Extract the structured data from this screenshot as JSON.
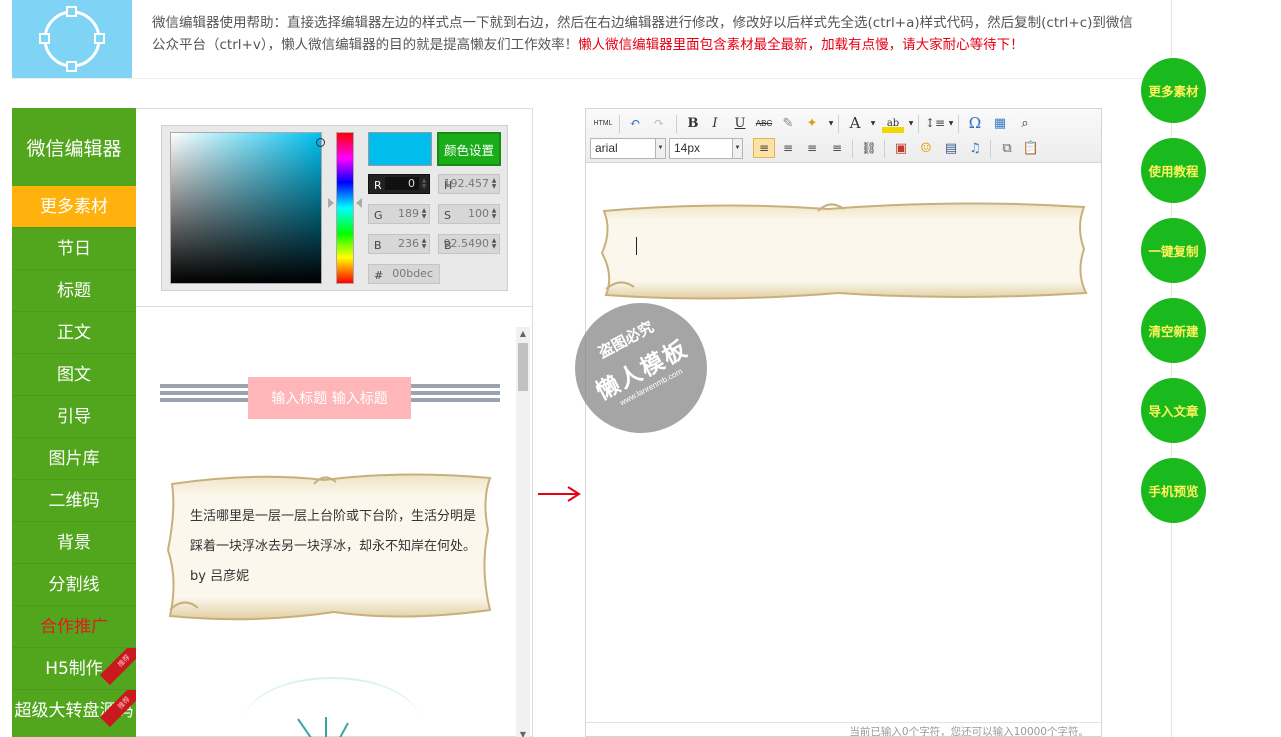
{
  "header": {
    "help_text": "微信编辑器使用帮助：直接选择编辑器左边的样式点一下就到右边，然后在右边编辑器进行修改，修改好以后样式先全选(ctrl+a)样式代码，然后复制(ctrl+c)到微信公众平台（ctrl+v），懒人微信编辑器的目的就是提高懒友们工作效率！",
    "warning_text": "懒人微信编辑器里面包含素材最全最新，加载有点慢，请大家耐心等待下！"
  },
  "nav": {
    "title": "微信编辑器",
    "items": [
      {
        "label": "更多素材"
      },
      {
        "label": "节日"
      },
      {
        "label": "标题"
      },
      {
        "label": "正文"
      },
      {
        "label": "图文"
      },
      {
        "label": "引导"
      },
      {
        "label": "图片库"
      },
      {
        "label": "二维码"
      },
      {
        "label": "背景"
      },
      {
        "label": "分割线"
      },
      {
        "label": "合作推广"
      },
      {
        "label": "H5制作",
        "ribbon": "推荐"
      },
      {
        "label": "超级大转盘源码",
        "ribbon": "推荐"
      }
    ]
  },
  "color_picker": {
    "button_label": "颜色设置",
    "fields": {
      "r": {
        "label": "R",
        "value": "0"
      },
      "h": {
        "label": "H",
        "value": "192.457"
      },
      "g": {
        "label": "G",
        "value": "189"
      },
      "s": {
        "label": "S",
        "value": "100"
      },
      "b": {
        "label": "B",
        "value": "236"
      },
      "b2": {
        "label": "B",
        "value": "92.5490"
      },
      "hex": {
        "label": "#",
        "value": "00bdec"
      }
    },
    "colors": {
      "current": "#00bdec"
    }
  },
  "styles": {
    "title_sample": "输入标题 输入标题",
    "scroll_text": "生活哪里是一层一层上台阶或下台阶，生活分明是踩着一块浮冰去另一块浮冰，却永不知岸在何处。 by 吕彦妮"
  },
  "editor": {
    "font_family": "arial",
    "font_size": "14px",
    "html_label": "HTML",
    "footer": "当前已输入0个字符，您还可以输入10000个字符。"
  },
  "watermark": {
    "line1": "盗图必究",
    "line2": "懒人模板",
    "line3": "www.lanrenmb.com"
  },
  "side_buttons": [
    {
      "label": "更多素材"
    },
    {
      "label": "使用教程"
    },
    {
      "label": "一键复制"
    },
    {
      "label": "清空新建"
    },
    {
      "label": "导入文章"
    },
    {
      "label": "手机预览"
    }
  ],
  "colors": {
    "nav_green": "#52a61d",
    "nav_active": "#ffb10d",
    "side_button": "#1aba1e",
    "side_button_text": "#fff25c",
    "warning": "#e60012"
  }
}
